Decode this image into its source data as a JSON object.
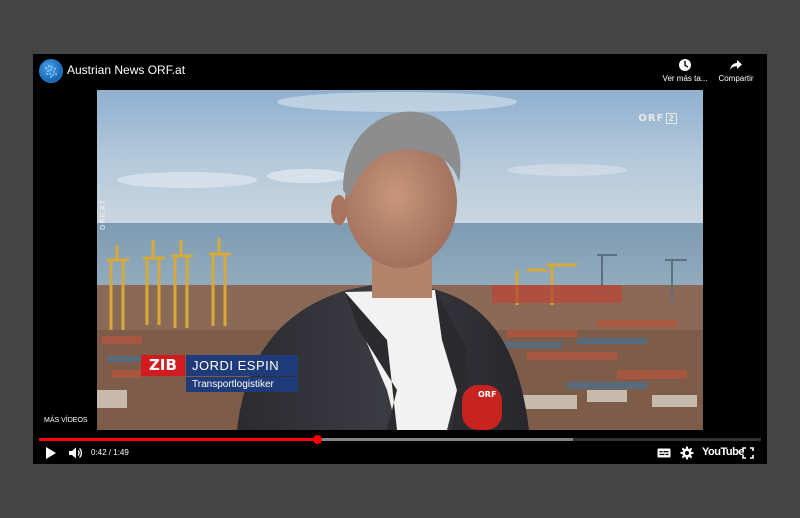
{
  "player": {
    "channel_title": "Austrian News ORF.at",
    "watch_later_label": "Ver más ta...",
    "share_label": "Compartir",
    "more_videos_label": "MÁS VÍDEOS",
    "time_display": "0:42 / 1:49",
    "progress": {
      "played_fraction": 0.385,
      "buffered_fraction": 0.74
    },
    "youtube_logo": "YouTube",
    "accent_color": "#ff0000"
  },
  "video_overlay": {
    "broadcaster_bug": "ORF",
    "broadcaster_channel": "2",
    "side_watermark": "ORF.AT",
    "show_tag": "ZIB",
    "person_name": "JORDI ESPIN",
    "person_role": "Transportlogistiker",
    "mic_label": "ORF",
    "zib_color": "#d21a1f",
    "plate_color": "#1f3b7a"
  },
  "icons": {
    "channel": "globe-icon",
    "watch_later": "clock-icon",
    "share": "share-arrow-icon",
    "play": "play-icon",
    "volume": "volume-icon",
    "captions": "subtitles-icon",
    "settings": "gear-icon",
    "fullscreen": "fullscreen-icon"
  }
}
